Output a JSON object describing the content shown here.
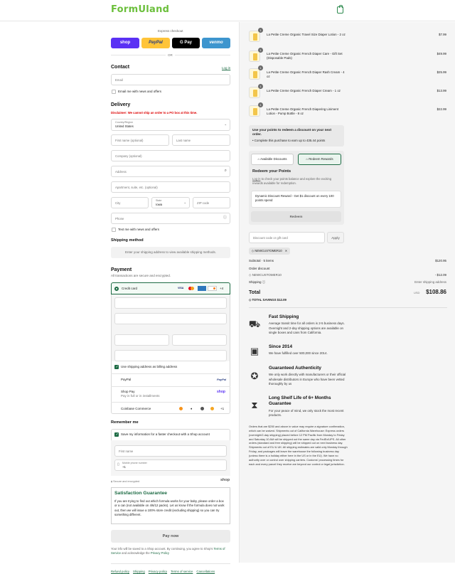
{
  "brand": {
    "logo": "FormUland"
  },
  "express": {
    "title": "Express checkout",
    "shop": "shop",
    "paypal": "PayPal",
    "gpay": "G Pay",
    "venmo": "venmo",
    "or": "OR"
  },
  "contact": {
    "title": "Contact",
    "login": "Log in",
    "email_placeholder": "Email",
    "news": "Email me with news and offers"
  },
  "delivery": {
    "title": "Delivery",
    "disclaimer": "Disclaimer: We cannot ship an order to a PO box at this time.",
    "country_label": "Country/Region",
    "country": "United States",
    "first": "First name (optional)",
    "last": "Last name",
    "company": "Company (optional)",
    "address": "Address",
    "apt": "Apartment, suite, etc. (optional)",
    "city": "City",
    "state_label": "State",
    "state": "Iowa",
    "zip": "ZIP code",
    "phone": "Phone",
    "text_news": "Text me with news and offers"
  },
  "shipping": {
    "title": "Shipping method",
    "note": "Enter your shipping address to view available shipping methods."
  },
  "payment": {
    "title": "Payment",
    "subtitle": "All transactions are secure and encrypted.",
    "credit": "Credit card",
    "more": "+4",
    "billing": "Use shipping address as billing address",
    "paypal": "PayPal",
    "shop_pay": "Shop Pay",
    "shop_pay_sub": "Pay in full or in installments",
    "coinbase": "Coinbase Commerce",
    "coin_more": "+1"
  },
  "remember": {
    "title": "Remember me",
    "save": "Save my information for a faster checkout with a Shop account",
    "first": "First name",
    "mobile_label": "Mobile phone number",
    "mobile_prefix": "+1",
    "secure": "Secure and encrypted",
    "shop": "shop"
  },
  "guarantee": {
    "title": "Satisfaction Guarantee",
    "text": "If you are trying to find out which formula works for your baby, please order a box or a can (not available on 4/6/12 packs). Let us know if the formula does not work out, then we will issue a 100% store credit (excluding shipping) so you can try something different."
  },
  "pay": {
    "label": "Pay now",
    "terms_pre": "Your info will be saved to a Shop account. By continuing, you agree to Shop's",
    "tos": "Terms of Service",
    "and": "and acknowledge the",
    "privacy": "Privacy Policy"
  },
  "footer": [
    "Refund policy",
    "Shipping",
    "Privacy policy",
    "Terms of service",
    "Cancellations"
  ],
  "cart": {
    "items": [
      {
        "qty": "1",
        "name": "La Petite Creme Organic Travel Size Diaper Lotion - 2 oz",
        "price": "$7.99"
      },
      {
        "qty": "1",
        "name": "La Petite Creme Organic French Diaper Care - Gift Set (Disposable Pads)",
        "price": "$49.99"
      },
      {
        "qty": "1",
        "name": "La Petite Creme Organic French Diaper Rash Cream - 4 oz",
        "price": "$25.99"
      },
      {
        "qty": "1",
        "name": "La Petite Creme Organic French Diaper Cream - 1 oz",
        "price": "$13.99"
      },
      {
        "qty": "1",
        "name": "La Petite Creme Organic French Diapering Liniment Lotion - Pump Bottle - 8 oz",
        "price": "$22.99"
      }
    ]
  },
  "points": {
    "title": "Use your points to redeem a discount on your next order.",
    "bullet": "Complete this purchase to earn up to 435.44 points",
    "tab_discounts": "Available Discounts",
    "tab_rewards": "Redeem Rewards",
    "redeem_title": "Redeem your Points",
    "login": "Log in",
    "login_rest": "to check your points balance and explore the exciting rewards available for redemption.",
    "reward": "Dynamic Discount Reward - Get $1 discount on every 100 points spend",
    "redeem_btn": "Redeem"
  },
  "discount": {
    "placeholder": "Discount code or gift card",
    "apply": "Apply",
    "code": "NEWCUSTOMER10"
  },
  "summary": {
    "subtotal_label": "Subtotal · 5 items",
    "subtotal": "$120.95",
    "order_discount": "Order discount",
    "code": "NEWCUSTOMER10",
    "code_value": "- $12.09",
    "shipping_label": "Shipping",
    "shipping_value": "Enter shipping address",
    "total_label": "Total",
    "currency": "USD",
    "total": "$108.86",
    "savings_label": "TOTAL SAVINGS",
    "savings": "$12.09"
  },
  "features": [
    {
      "icon": "truck-icon",
      "title": "Fast Shipping",
      "desc": "Average transit time for all orders is 2-5 business days. Overnight and 2-day shipping options are available on single boxes and cans from California."
    },
    {
      "icon": "box-icon",
      "title": "Since 2014",
      "desc": "We have fulfilled over 500,000 since 2014."
    },
    {
      "icon": "badge-check-icon",
      "title": "Guaranteed Authenticity",
      "desc": "We only work directly with manufacturers or their official wholesale distributors in Europe who have been vetted thoroughly by us"
    },
    {
      "icon": "hourglass-icon",
      "title": "Long Shelf Life of 6+ Months Guarantee",
      "desc": "For your peace of mind, we only stock the most recent products."
    }
  ],
  "policy": "Orders that are $250 and above in value may require a signature confirmation, which can be waived. Shipments out of California Warehouse: Express orders (overnight/2-day shipping) placed before 12 PM Pacific from Monday to Friday and Saturday 10 AM will be shipped out the same day via FedEx/UPS. All other orders (standard and free shipping) will be shipped out on next business day. Shipments out of EU & UK: All shipping estimates are valid only Monday through Friday, and packages will leave the warehouse the following business day (unless there is a holiday either here in the US or in the EU). We have no authority over or control over shipping carriers. Customs' processing times for each and every parcel they receive are beyond our control or legal jurisdiction."
}
